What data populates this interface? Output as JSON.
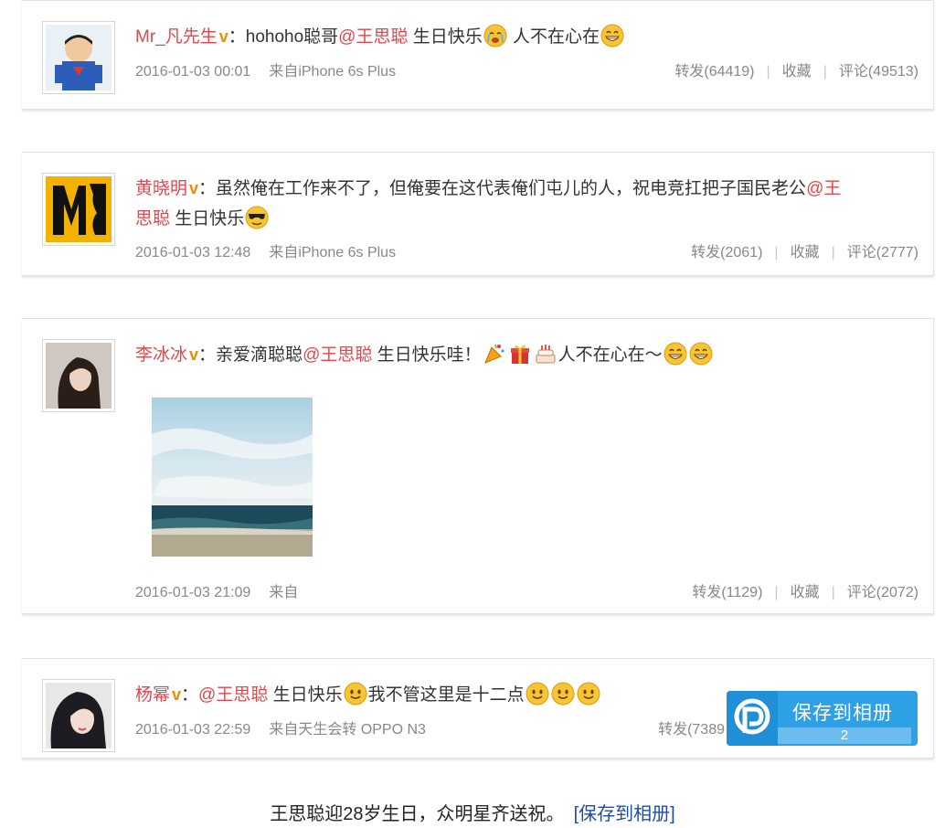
{
  "posts": [
    {
      "user": "Mr_凡先生",
      "verified": "v",
      "colon": "：",
      "text_before": "hohoho聪哥",
      "mention": "@王思聪",
      "text_after": " 生日快乐",
      "text_after2": " 人不在心在",
      "time": "2016-01-03 00:01",
      "source": "来自iPhone 6s Plus",
      "repost": "转发(64419)",
      "favorite": "收藏",
      "comment": "评论(49513)"
    },
    {
      "user": "黄晓明",
      "verified": "v",
      "colon": "：",
      "line1": "虽然俺在工作来不了，但俺要在这代表俺们屯儿的人，祝电竞扛把子国民老公",
      "mention_part1": "@王",
      "mention_part2": "思聪",
      "line2": " 生日快乐",
      "time": "2016-01-03 12:48",
      "source": "来自iPhone 6s Plus",
      "repost": "转发(2061)",
      "favorite": "收藏",
      "comment": "评论(2777)"
    },
    {
      "user": "李冰冰",
      "verified": "v",
      "colon": "：",
      "text_before": "亲爱滴聪聪",
      "mention": "@王思聪",
      "text_after": " 生日快乐哇！",
      "text_after2": "人不在心在～",
      "time": "2016-01-03 21:09",
      "source": "来自",
      "repost": "转发(1129)",
      "favorite": "收藏",
      "comment": "评论(2072)"
    },
    {
      "user": "杨幂",
      "verified": "v",
      "colon": "：",
      "mention": "@王思聪",
      "text_after": " 生日快乐",
      "text_after2": "我不管这里是十二点",
      "time": "2016-01-03 22:59",
      "source": "来自天生会转 OPPO N3",
      "repost": "转发(7389"
    }
  ],
  "save_button": {
    "label": "保存到相册",
    "count": "2"
  },
  "caption": {
    "text": "王思聪迎28岁生日，众明星齐送祝。",
    "link": "[保存到相册]"
  },
  "colors": {
    "username": "#e0474c",
    "mention": "#e0474c",
    "verified": "#f08a00",
    "meta": "#888888",
    "save_bg": "#2ea0e6",
    "caption_link": "#1f4fa0"
  },
  "icons": [
    "avatar-superman",
    "avatar-m-logo",
    "avatar-woman",
    "avatar-woman-2",
    "emoji-cry",
    "emoji-grin",
    "emoji-cool",
    "emoji-party",
    "emoji-gift",
    "emoji-cake",
    "emoji-smile",
    "save-album-logo"
  ]
}
